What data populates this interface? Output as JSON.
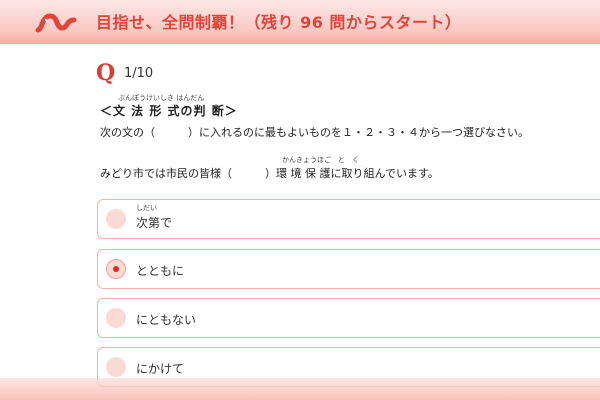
{
  "header": {
    "title": "目指せ、全問制覇！（残り 96 問からスタート）",
    "logo_icon": "worm-logo-icon",
    "accent_color": "#e4433a"
  },
  "question": {
    "mark": "Q",
    "number": "1/10",
    "category_ruby": "ぶんぽうけいしき はんだん",
    "category": "＜文 法 形 式の判 断＞",
    "instruction": "次の文の（　　　）に入れるのに最もよいものを１・２・３・４から一つ選びなさい。",
    "sentence_ruby": "かんきょうほご　と　く",
    "sentence": "みどり市では市民の皆様（　　　）環 境 保 護に取り組んでいます。"
  },
  "choices": [
    {
      "ruby": "しだい",
      "label": "次第で",
      "selected": false
    },
    {
      "ruby": "",
      "label": "とともに",
      "selected": true
    },
    {
      "ruby": "",
      "label": "にともない",
      "selected": false
    },
    {
      "ruby": "",
      "label": "にかけて",
      "selected": false
    }
  ]
}
